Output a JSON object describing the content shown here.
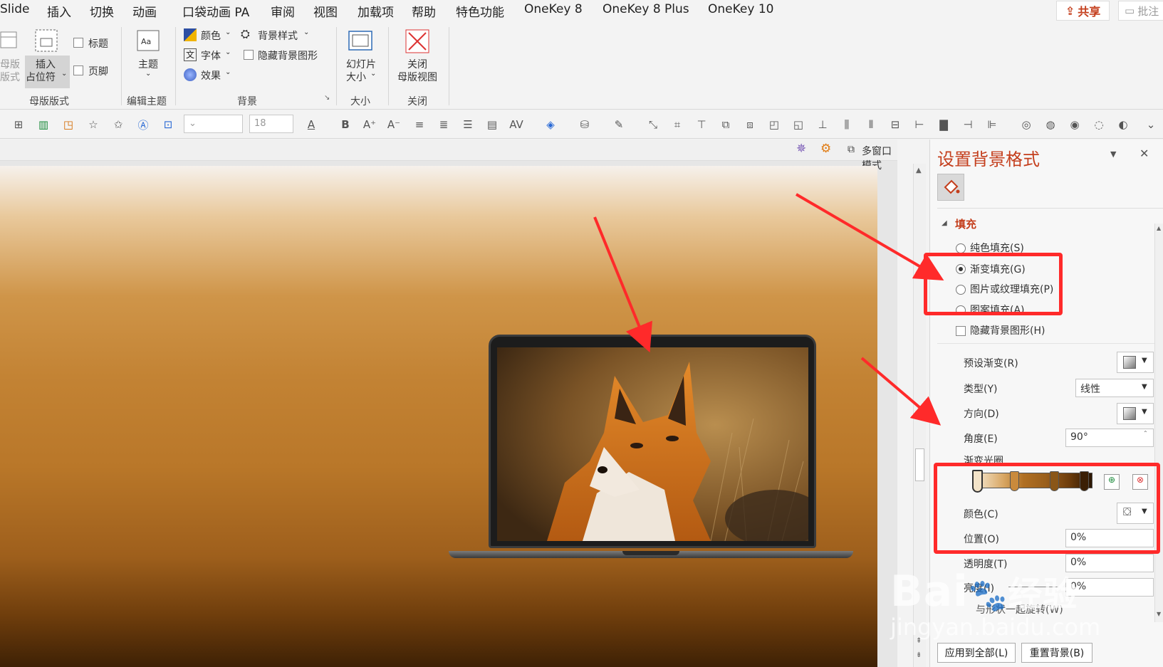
{
  "menu": [
    "Slide",
    "插入",
    "切换",
    "动画",
    "口袋动画 PA",
    "审阅",
    "视图",
    "加载项",
    "帮助",
    "特色功能",
    "OneKey 8",
    "OneKey 8 Plus",
    "OneKey 10"
  ],
  "share_label": "共享",
  "comment_label": "批注",
  "ribbon": {
    "master_layout_1": "母版",
    "master_layout_2": "版式",
    "insert_placeholder_1": "插入",
    "insert_placeholder_2": "占位符",
    "title_check": "标题",
    "footer_check": "页脚",
    "group_master_layout": "母版版式",
    "theme": "主题",
    "group_edit_theme": "编辑主题",
    "colors": "颜色",
    "fonts": "字体",
    "effects": "效果",
    "bg_styles": "背景样式",
    "hide_bg": "隐藏背景图形",
    "group_background": "背景",
    "slide_size_1": "幻灯片",
    "slide_size_2": "大小",
    "group_size": "大小",
    "close_master_1": "关闭",
    "close_master_2": "母版视图",
    "group_close": "关闭"
  },
  "toolbar": {
    "font_size": "18"
  },
  "workspace": {
    "multi_window": "多窗口模式"
  },
  "panel": {
    "title": "设置背景格式",
    "fill_header": "填充",
    "solid_fill": "纯色填充(S)",
    "gradient_fill": "渐变填充(G)",
    "picture_fill": "图片或纹理填充(P)",
    "pattern_fill": "图案填充(A)",
    "hide_bg": "隐藏背景图形(H)",
    "preset": "预设渐变(R)",
    "type": "类型(Y)",
    "type_value": "线性",
    "direction": "方向(D)",
    "angle": "角度(E)",
    "angle_value": "90°",
    "stops": "渐变光圈",
    "color": "颜色(C)",
    "position": "位置(O)",
    "position_value": "0%",
    "transparency": "透明度(T)",
    "transparency_value": "0%",
    "brightness": "亮度(I)",
    "brightness_value": "0%",
    "rotate": "与形状一起旋转(W)",
    "apply_all": "应用到全部(L)",
    "reset_bg": "重置背景(B)"
  },
  "colors": {
    "accent": "#c43e1c",
    "annotation": "#ff2a2a"
  },
  "watermark": {
    "brand": "Bai",
    "brand_cn": "经验",
    "url": "jingyan.baidu.com"
  }
}
